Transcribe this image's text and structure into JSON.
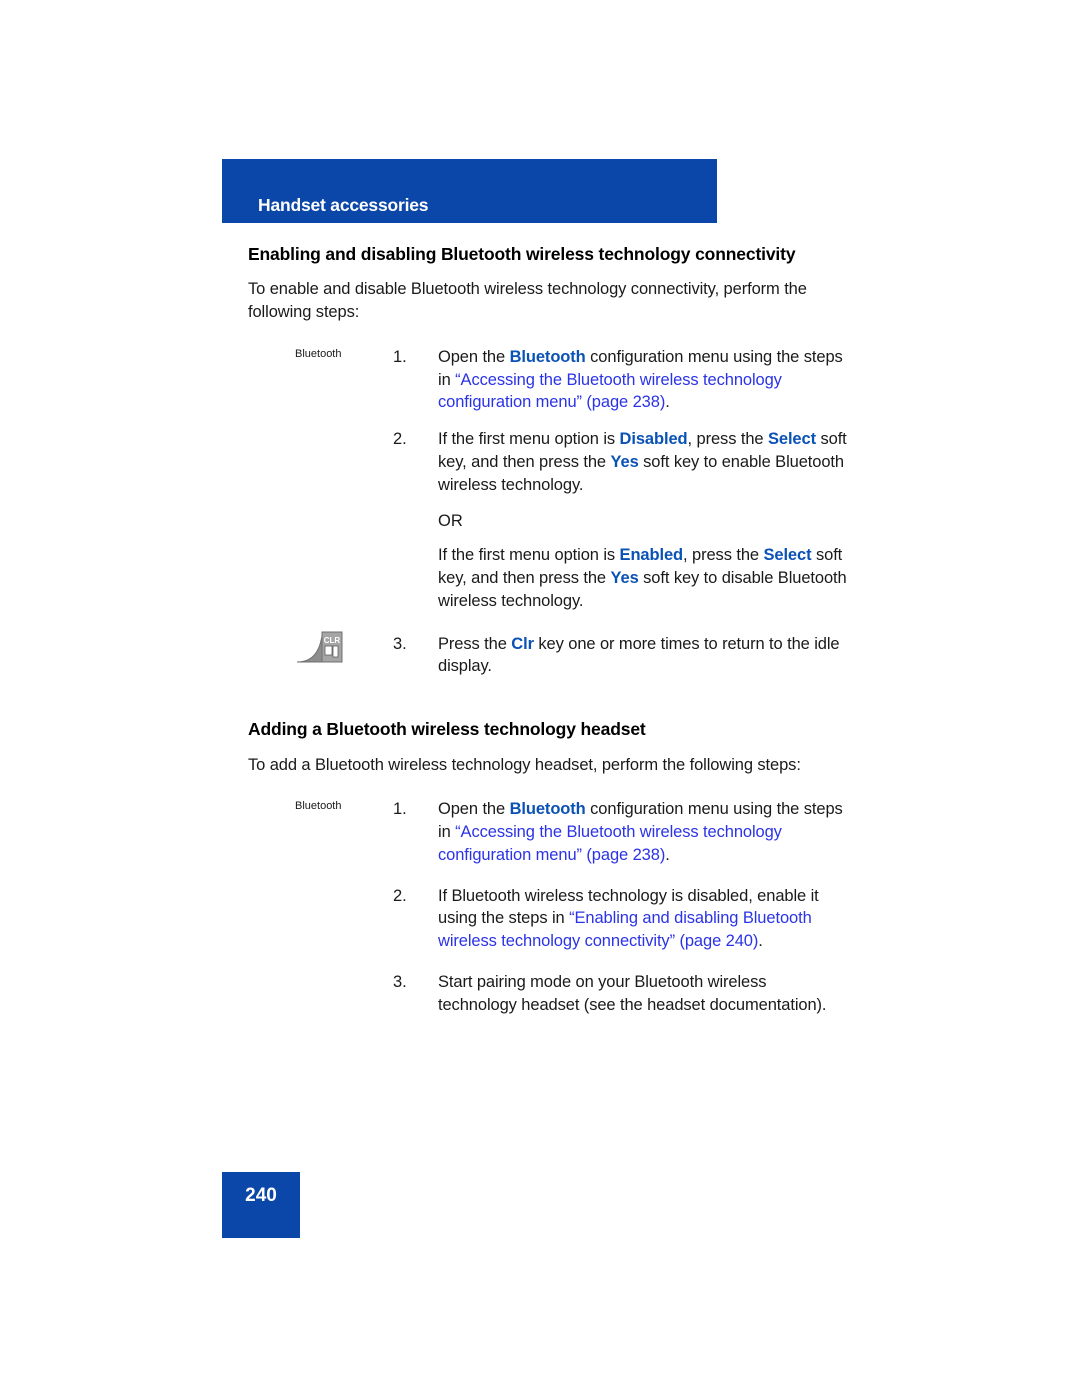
{
  "header": {
    "banner_title": "Handset accessories",
    "banner_color": "#0B47A8"
  },
  "colors": {
    "banner_blue": "#0B47A8",
    "accent_blue": "#0B52B5",
    "xref_blue": "#2B33E6",
    "body_black": "#1a1a1a",
    "key_icon_gray": "#9a9a9a"
  },
  "sections": [
    {
      "heading": "Enabling and disabling Bluetooth wireless technology connectivity",
      "intro": "To enable and disable Bluetooth wireless technology connectivity, perform the following steps:",
      "steps": [
        {
          "number": "1.",
          "margin_label": "Bluetooth",
          "text_parts": [
            {
              "t": "Open the ",
              "style": "plain"
            },
            {
              "t": "Bluetooth",
              "style": "accent"
            },
            {
              "t": " configuration menu using the steps in ",
              "style": "plain"
            },
            {
              "t": "“Accessing the Bluetooth wireless technology configuration menu” (page 238)",
              "style": "xref"
            },
            {
              "t": ".",
              "style": "plain"
            }
          ]
        },
        {
          "number": "2.",
          "margin_label": "",
          "text_parts": [
            {
              "t": "If the first menu option is ",
              "style": "plain"
            },
            {
              "t": "Disabled",
              "style": "accent"
            },
            {
              "t": ", press the ",
              "style": "plain"
            },
            {
              "t": "Select",
              "style": "accent"
            },
            {
              "t": " soft key, and then press the ",
              "style": "plain"
            },
            {
              "t": "Yes",
              "style": "accent"
            },
            {
              "t": " soft key to enable Bluetooth wireless technology.",
              "style": "plain"
            }
          ],
          "or_label": "OR",
          "or_parts": [
            {
              "t": "If the first menu option is ",
              "style": "plain"
            },
            {
              "t": "Enabled",
              "style": "accent"
            },
            {
              "t": ", press the ",
              "style": "plain"
            },
            {
              "t": "Select",
              "style": "accent"
            },
            {
              "t": " soft key, and then press the ",
              "style": "plain"
            },
            {
              "t": "Yes",
              "style": "accent"
            },
            {
              "t": " soft key to disable Bluetooth wireless technology.",
              "style": "plain"
            }
          ]
        },
        {
          "number": "3.",
          "margin_icon": "clr-key-icon",
          "margin_icon_label": "CLR",
          "text_parts": [
            {
              "t": "Press the ",
              "style": "plain"
            },
            {
              "t": "Clr",
              "style": "accent"
            },
            {
              "t": " key one or more times to return to the idle display.",
              "style": "plain"
            }
          ]
        }
      ]
    },
    {
      "heading": "Adding a Bluetooth wireless technology headset",
      "intro": "To add a Bluetooth wireless technology headset, perform the following steps:",
      "steps": [
        {
          "number": "1.",
          "margin_label": "Bluetooth",
          "text_parts": [
            {
              "t": "Open the ",
              "style": "plain"
            },
            {
              "t": "Bluetooth",
              "style": "accent"
            },
            {
              "t": " configuration menu using the steps in ",
              "style": "plain"
            },
            {
              "t": "“Accessing the Bluetooth wireless technology configuration menu” (page 238)",
              "style": "xref"
            },
            {
              "t": ".",
              "style": "plain"
            }
          ]
        },
        {
          "number": "2.",
          "margin_label": "",
          "text_parts": [
            {
              "t": "If Bluetooth wireless technology is disabled, enable it using the steps in ",
              "style": "plain"
            },
            {
              "t": "“Enabling and disabling Bluetooth wireless technology connectivity” (page 240)",
              "style": "xref"
            },
            {
              "t": ".",
              "style": "plain"
            }
          ]
        },
        {
          "number": "3.",
          "margin_label": "",
          "text_parts": [
            {
              "t": "Start pairing mode on your Bluetooth wireless technology headset (see the headset documentation).",
              "style": "plain"
            }
          ]
        }
      ]
    }
  ],
  "footer": {
    "page_number": "240"
  }
}
